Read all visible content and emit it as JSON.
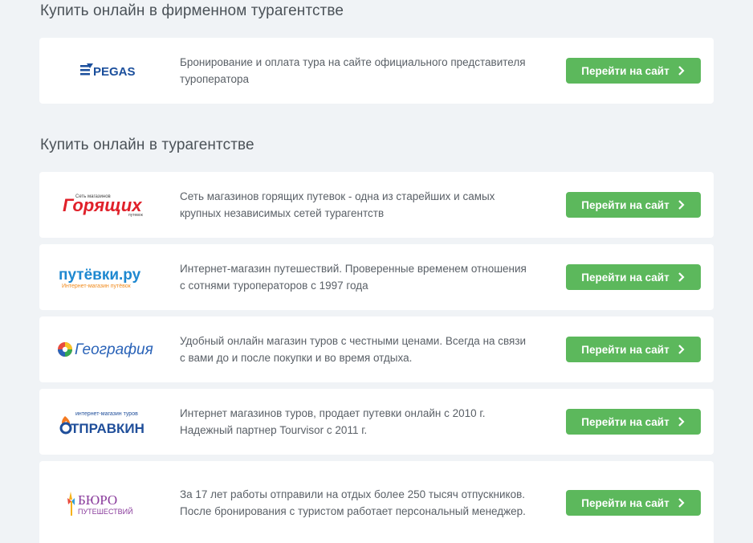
{
  "sections": [
    {
      "title": "Купить онлайн в фирменном турагентстве"
    },
    {
      "title": "Купить онлайн в турагентстве"
    }
  ],
  "button_label": "Перейти на сайт",
  "agencies": [
    {
      "logo_text": "PEGAS",
      "description": "Бронирование и оплата тура на сайте официального представителя туроператора"
    },
    {
      "logo_text": "Горящих",
      "logo_small_top": "Сеть магазинов",
      "logo_small_bottom": "путевок",
      "description": "Сеть магазинов горящих путевок - одна из старейших и самых крупных независимых сетей турагентств"
    },
    {
      "logo_text": "путёвки.ру",
      "logo_sub": "Интернет-магазин путёвок",
      "description": "Интернет-магазин путешествий. Проверенные временем отношения с сотнями туроператоров с 1997 года"
    },
    {
      "logo_text": "География",
      "description": "Удобный онлайн магазин туров с честными ценами. Всегда на связи с вами до и после покупки и во время отдыха."
    },
    {
      "logo_text": "ОТПРАВКИН",
      "logo_sub": "интернет-магазин туров",
      "description": "Интернет магазинов туров, продает путевки онлайн с 2010 г. Надежный партнер Tourvisor с 2011 г."
    },
    {
      "logo_text": "БЮРО",
      "logo_sub": "ПУТЕШЕСТВИЙ",
      "description": "За 17 лет работы отправили на отдых более 250 тысяч отпускников. После бронирования с туристом работает персональный менеджер."
    }
  ],
  "colors": {
    "background": "#f0f3f6",
    "button": "#5cb85c",
    "pegas_blue": "#1b4f9c",
    "goryashih_red": "#e0212a",
    "putevki_blue": "#1e88d0",
    "putevki_orange": "#f08a1c",
    "geografia_blue": "#2a63b8",
    "otpravkin_blue": "#1f4e9a",
    "buro_purple": "#8a3c9c"
  }
}
